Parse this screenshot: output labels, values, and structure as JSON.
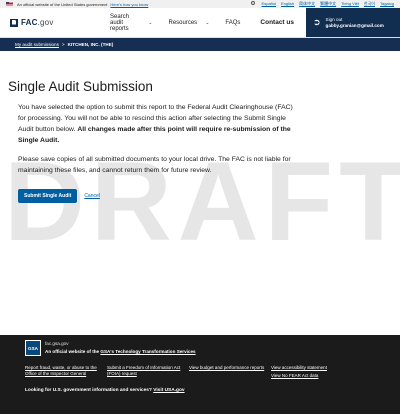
{
  "gov_banner": {
    "official_text": "An official website of the United States government",
    "how_link": "Here's how you know",
    "languages": [
      "Español",
      "English",
      "简体中文",
      "繁體中文",
      "Tiếng Việt",
      "한국어",
      "Tagalog"
    ]
  },
  "header": {
    "logo_text": "FAC",
    "logo_suffix": ".gov",
    "nav": [
      {
        "label": "Search audit reports",
        "has_dropdown": true
      },
      {
        "label": "Resources",
        "has_dropdown": true
      },
      {
        "label": "FAQs",
        "has_dropdown": false
      }
    ],
    "contact_label": "Contact us",
    "signout_label": "Sign out",
    "user_email": "gabby.granian@gmail.com"
  },
  "breadcrumb": {
    "link": "My audit submissions",
    "separator": ">",
    "current": "KITCHEN, INC. (THE)"
  },
  "main": {
    "watermark": "DRAFT",
    "title": "Single Audit Submission",
    "para1_plain": "You have selected the option to submit this report to the Federal Audit Clearinghouse (FAC) for processing. You will not be able to rescind this action after selecting the Submit Single Audit button below. ",
    "para1_bold": "All changes made after this point will require re-submission of the Single Audit.",
    "para2": "Please save copies of all submitted documents to your local drive. The FAC is not liable for maintaining these files, and cannot return them for future review.",
    "submit_label": "Submit Single Audit",
    "cancel_label": "Cancel"
  },
  "footer": {
    "gsa_logo": "GSA",
    "domain": "fac.gsa.gov",
    "official_prefix": "An official website of the ",
    "official_link": "GSA's Technology Transformation Services",
    "link_columns": [
      [
        "Report fraud, waste, or abuse to the Office of the Inspector General"
      ],
      [
        "Submit a Freedom of Information Act (FOIA) request"
      ],
      [
        "View budget and performance reports"
      ],
      [
        "View accessibility statement",
        "View No FEAR Act data"
      ]
    ],
    "bottom_prefix": "Looking for U.S. government information and services? ",
    "bottom_link": "Visit USA.gov"
  },
  "colors": {
    "navy": "#112e51",
    "crumb_bg": "#162e51",
    "primary": "#005ea2",
    "footer_bg": "#1b1b1b",
    "watermark": "#e6e6e6"
  }
}
